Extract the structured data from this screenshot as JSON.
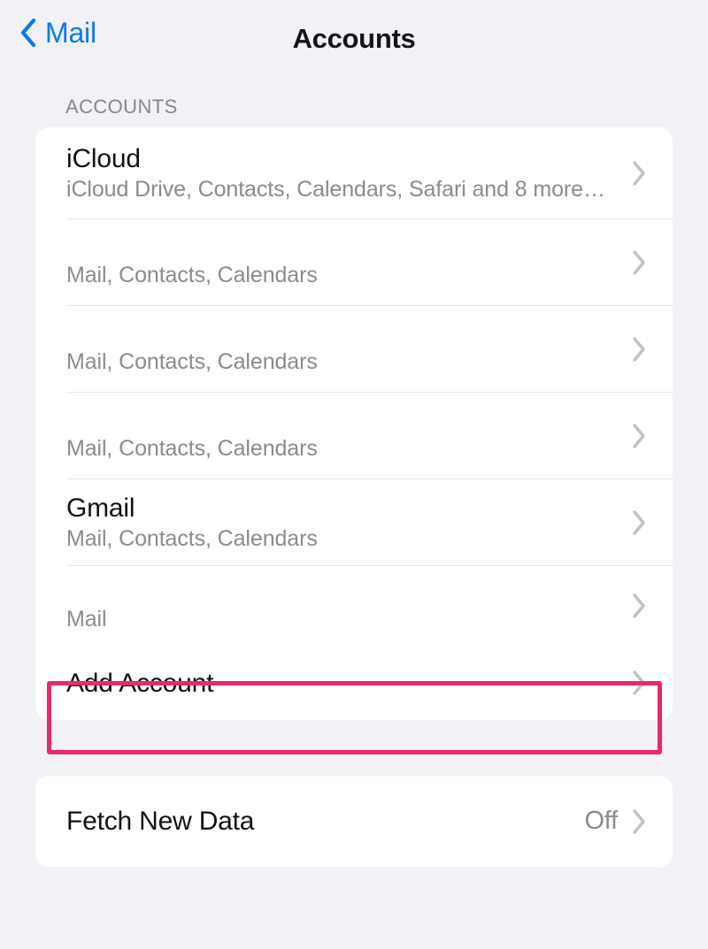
{
  "navbar": {
    "back_label": "Mail",
    "back_icon": "chevron-left-icon",
    "title": "Accounts"
  },
  "accounts_section": {
    "header": "ACCOUNTS",
    "rows": [
      {
        "title": "iCloud",
        "subtitle": "iCloud Drive, Contacts, Calendars, Safari and 8 more…",
        "value": "",
        "chevron": "chevron-right-icon"
      },
      {
        "title": "",
        "subtitle": "Mail, Contacts, Calendars",
        "value": "",
        "chevron": "chevron-right-icon"
      },
      {
        "title": "",
        "subtitle": "Mail, Contacts, Calendars",
        "value": "",
        "chevron": "chevron-right-icon"
      },
      {
        "title": "",
        "subtitle": "Mail, Contacts, Calendars",
        "value": "",
        "chevron": "chevron-right-icon"
      },
      {
        "title": "Gmail",
        "subtitle": "Mail, Contacts, Calendars",
        "value": "",
        "chevron": "chevron-right-icon"
      },
      {
        "title": "",
        "subtitle": "Mail",
        "value": "",
        "chevron": "chevron-right-icon"
      },
      {
        "title": "Add Account",
        "subtitle": "",
        "value": "",
        "chevron": "chevron-right-icon"
      }
    ]
  },
  "fetch_section": {
    "rows": [
      {
        "title": "Fetch New Data",
        "subtitle": "",
        "value": "Off",
        "chevron": "chevron-right-icon"
      }
    ]
  },
  "annotation": {
    "target": "Add Account",
    "color": "#e8296b"
  },
  "colors": {
    "background": "#f1f1f6",
    "card": "#ffffff",
    "accent_link": "#0a79e8",
    "primary_text": "#121216",
    "secondary_text": "#8b8b90",
    "separator": "#e6e6e8",
    "highlight": "#e8296b"
  }
}
